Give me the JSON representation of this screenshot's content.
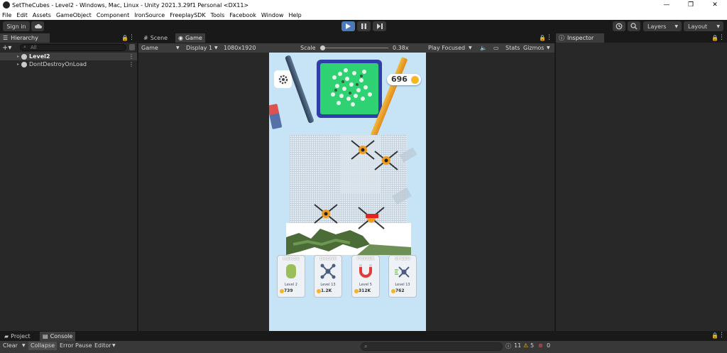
{
  "window": {
    "title": "SetTheCubes - Level2 - Windows, Mac, Linux - Unity 2021.3.29f1 Personal <DX11>",
    "controls": [
      "—",
      "❐",
      "✕"
    ]
  },
  "menu": [
    "File",
    "Edit",
    "Assets",
    "GameObject",
    "Component",
    "IronSource",
    "FreeplaySDK",
    "Tools",
    "Facebook",
    "Window",
    "Help"
  ],
  "toolbar": {
    "sign_in": "Sign in",
    "layers": "Layers",
    "layout": "Layout"
  },
  "hierarchy": {
    "tab": "Hierarchy",
    "search_placeholder": "All",
    "items": [
      "Level2",
      "DontDestroyOnLoad"
    ]
  },
  "center_tabs": [
    "Scene",
    "Game"
  ],
  "gamebar": {
    "mode": "Game",
    "display": "Display 1",
    "resolution": "1080x1920",
    "scale_label": "Scale",
    "scale_value": "0.38x",
    "play_mode": "Play Focused",
    "stats": "Stats",
    "gizmos": "Gizmos"
  },
  "inspector": {
    "tab": "Inspector"
  },
  "game": {
    "coins": "696",
    "cards": [
      {
        "title": "MERGE",
        "level": "Level 2",
        "price": "739"
      },
      {
        "title": "DRONE",
        "level": "Level 13",
        "price": "1.2K"
      },
      {
        "title": "POWER",
        "level": "Level 5",
        "price": "312K"
      },
      {
        "title": "SPEED",
        "level": "Level 13",
        "price": "762"
      }
    ]
  },
  "bottom_tabs": [
    "Project",
    "Console"
  ],
  "console": {
    "clear": "Clear",
    "collapse": "Collapse",
    "error_pause": "Error Pause",
    "editor": "Editor",
    "log_count": "11",
    "warn_count": "5",
    "error_count": "0"
  },
  "colors": {
    "accent": "#4a7ab8",
    "panel": "#282828",
    "game_bg": "#c7e4f6"
  }
}
